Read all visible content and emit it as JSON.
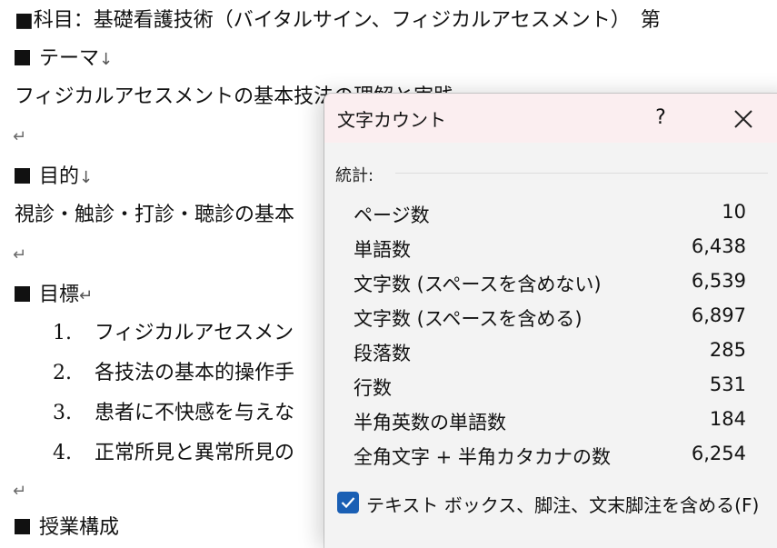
{
  "document": {
    "subject_line": "■科目：基礎看護技術（バイタルサイン、フィジカルアセスメント）　第",
    "theme_heading": "テーマ",
    "theme_text": "フィジカルアセスメントの基本技法の理解と実践",
    "purpose_heading": "目的",
    "purpose_text": "視診・触診・打診・聴診の基本",
    "goals_heading": "目標",
    "goals": [
      {
        "num": "1.",
        "text": "フィジカルアセスメン"
      },
      {
        "num": "2.",
        "text": "各技法の基本的操作手"
      },
      {
        "num": "3.",
        "text": "患者に不快感を与えな"
      },
      {
        "num": "4.",
        "text": "正常所見と異常所見の"
      }
    ],
    "next_heading_partial": "授業構成",
    "para_mark": "↵",
    "down_mark": "↓"
  },
  "dialog": {
    "title": "文字カウント",
    "help_label": "?",
    "stats_label": "統計:",
    "stats": [
      {
        "label": "ページ数",
        "value": "10"
      },
      {
        "label": "単語数",
        "value": "6,438"
      },
      {
        "label": "文字数 (スペースを含めない)",
        "value": "6,539"
      },
      {
        "label": "文字数 (スペースを含める)",
        "value": "6,897"
      },
      {
        "label": "段落数",
        "value": "285"
      },
      {
        "label": "行数",
        "value": "531"
      },
      {
        "label": "半角英数の単語数",
        "value": "184"
      },
      {
        "label": "全角文字 + 半角カタカナの数",
        "value": "6,254"
      }
    ],
    "include_textboxes_label": "テキスト ボックス、脚注、文末脚注を含める(F)",
    "include_textboxes_checked": true
  },
  "colors": {
    "title_bar": "#fbeef0",
    "checkbox_accent": "#1a5fb4"
  }
}
